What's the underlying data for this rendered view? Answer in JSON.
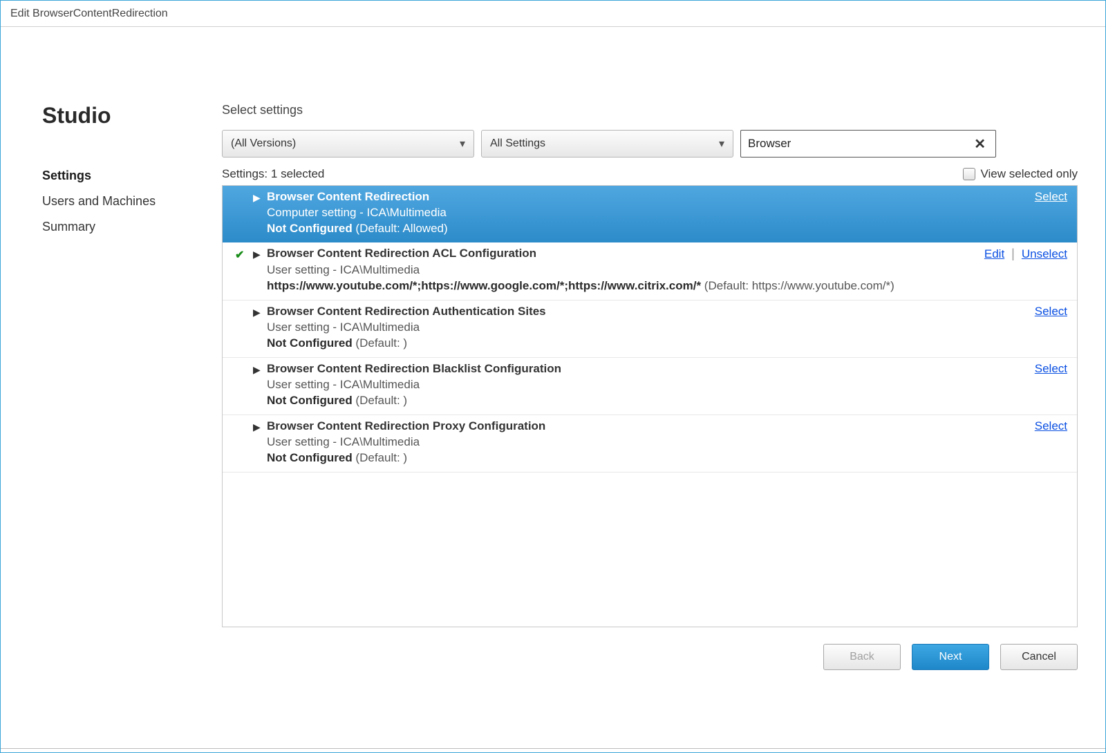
{
  "window": {
    "title": "Edit BrowserContentRedirection"
  },
  "brand": "Studio",
  "nav": [
    {
      "label": "Settings",
      "active": true
    },
    {
      "label": "Users and Machines",
      "active": false
    },
    {
      "label": "Summary",
      "active": false
    }
  ],
  "mainHeading": "Select settings",
  "filters": {
    "versions": "(All Versions)",
    "scope": "All Settings",
    "search": "Browser"
  },
  "listSummary": {
    "prefix": "Settings:",
    "count": "1 selected"
  },
  "viewSelectedLabel": "View selected only",
  "linkLabels": {
    "select": "Select",
    "edit": "Edit",
    "unselect": "Unselect"
  },
  "settings": [
    {
      "title": "Browser Content Redirection",
      "scope": "Computer setting - ICA\\Multimedia",
      "valueStrong": "Not Configured",
      "valueDefault": " (Default: Allowed)",
      "highlighted": true,
      "checked": false,
      "actions": [
        "select"
      ]
    },
    {
      "title": "Browser Content Redirection ACL Configuration",
      "scope": "User setting - ICA\\Multimedia",
      "valueStrong": "https://www.youtube.com/*;https://www.google.com/*;https://www.citrix.com/*",
      "valueDefault": " (Default: https://www.youtube.com/*)",
      "highlighted": false,
      "checked": true,
      "actions": [
        "edit",
        "unselect"
      ]
    },
    {
      "title": "Browser Content Redirection Authentication Sites",
      "scope": "User setting - ICA\\Multimedia",
      "valueStrong": "Not Configured",
      "valueDefault": " (Default: )",
      "highlighted": false,
      "checked": false,
      "actions": [
        "select"
      ]
    },
    {
      "title": "Browser Content Redirection Blacklist Configuration",
      "scope": "User setting - ICA\\Multimedia",
      "valueStrong": "Not Configured",
      "valueDefault": " (Default: )",
      "highlighted": false,
      "checked": false,
      "actions": [
        "select"
      ]
    },
    {
      "title": "Browser Content Redirection Proxy Configuration",
      "scope": "User setting - ICA\\Multimedia",
      "valueStrong": "Not Configured",
      "valueDefault": " (Default: )",
      "highlighted": false,
      "checked": false,
      "actions": [
        "select"
      ]
    }
  ],
  "footer": {
    "back": "Back",
    "next": "Next",
    "cancel": "Cancel"
  }
}
